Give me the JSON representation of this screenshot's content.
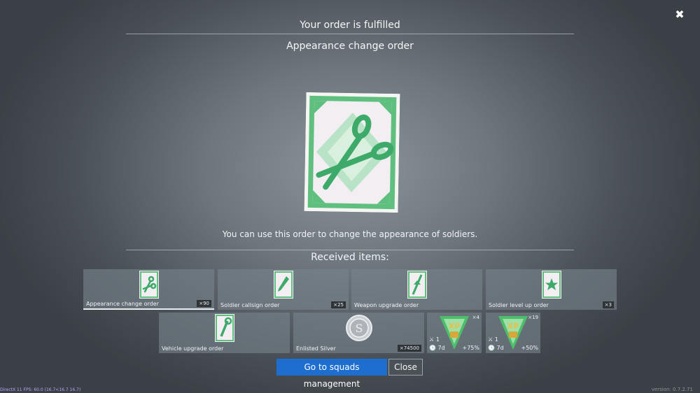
{
  "header": {
    "title": "Your order is fulfilled",
    "subtitle": "Appearance change order",
    "close_glyph": "✖"
  },
  "description": "You can use this order to change the appearance of soldiers.",
  "received_heading": "Received items:",
  "items": [
    {
      "label": "Appearance change order",
      "count": "×90",
      "icon": "scissors-order-icon"
    },
    {
      "label": "Soldier callsign order",
      "count": "×25",
      "icon": "pencil-order-icon"
    },
    {
      "label": "Weapon upgrade order",
      "count": "",
      "icon": "rifle-order-icon"
    },
    {
      "label": "Soldier level up order",
      "count": "×3",
      "icon": "star-order-icon"
    },
    {
      "label": "Vehicle upgrade order",
      "count": "",
      "icon": "wrench-order-icon"
    },
    {
      "label": "Enlisted Silver",
      "count": "×74500",
      "icon": "silver-coin-icon"
    }
  ],
  "boosters": [
    {
      "count": "×4",
      "battles": "1",
      "duration": "7d",
      "bonus": "+75%",
      "icon": "xp-booster-icon"
    },
    {
      "count": "×19",
      "battles": "1",
      "duration": "7d",
      "bonus": "+50%",
      "icon": "xp-booster-icon"
    }
  ],
  "buttons": {
    "primary": "Go to squads management",
    "secondary": "Close"
  },
  "footer": {
    "fps": "DirectX 11 FPS: 60.0 (16.7<16.7 16.7)",
    "version": "version: 0.7.2.71"
  },
  "colors": {
    "accent": "#1e6ed0",
    "order_green": "#3daa6a"
  }
}
